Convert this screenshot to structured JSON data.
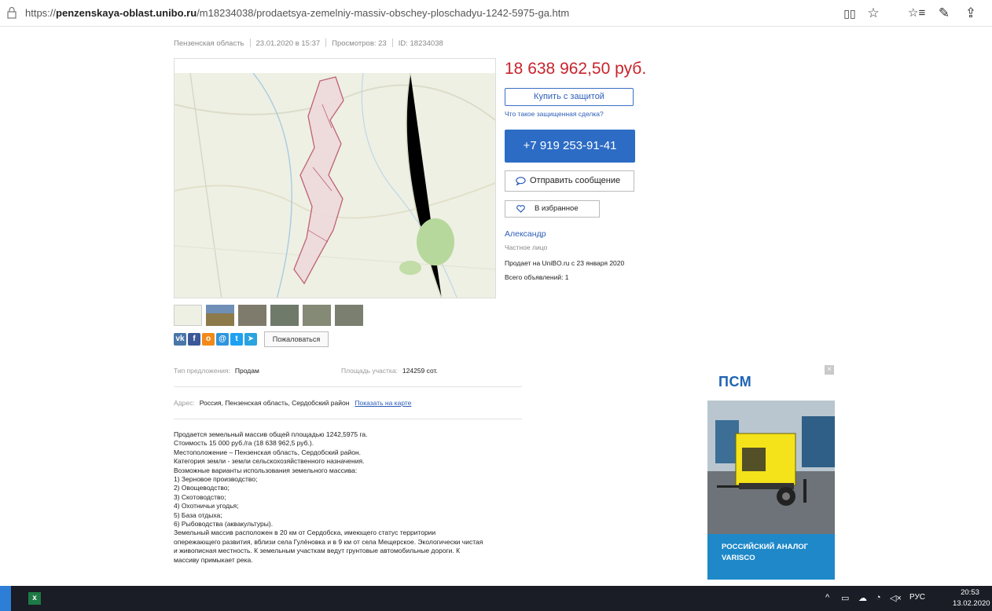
{
  "browser": {
    "url_prefix": "https://",
    "url_domain": "penzenskaya-oblast.unibo.ru",
    "url_path": "/m18234038/prodaetsya-zemelniy-massiv-obschey-ploschadyu-1242-5975-ga.htm"
  },
  "meta": {
    "region": "Пензенская область",
    "date": "23.01.2020 в 15:37",
    "views": "Просмотров: 23",
    "id": "ID: 18234038"
  },
  "listing": {
    "price": "18 638 962,50 руб.",
    "buy_protect_label": "Купить с защитой",
    "safe_deal_link": "Что такое защищенная сделка?",
    "phone": "+7 919 253-91-41",
    "message_label": "Отправить сообщение",
    "favorite_label": "В избранное"
  },
  "seller": {
    "name": "Александр",
    "type": "Частное лицо",
    "since": "Продает на UniBO.ru с 23 января 2020",
    "count": "Всего объявлений: 1"
  },
  "social": {
    "complain_label": "Пожаловаться",
    "items": [
      "vk",
      "facebook",
      "odnoklassniki",
      "moimir",
      "twitter",
      "telegram"
    ]
  },
  "details": {
    "offer_type_label": "Тип предложения:",
    "offer_type_value": "Продам",
    "area_label": "Площадь участка:",
    "area_value": "124259 сот.",
    "address_label": "Адрес:",
    "address_value": "Россия, Пензенская область, Сердобский район",
    "show_on_map": "Показать на карте"
  },
  "description": [
    "Продается земельный массив общей площадью 1242,5975 га.",
    "Стоимость 15 000 руб./га (18 638 962,5 руб.).",
    "Местоположение – Пензенская область, Сердобский район.",
    "Категория земли - земли сельскохозяйственного назначения.",
    "Возможные варианты использования земельного массива:",
    "1) Зерновое производство;",
    "2) Овощеводство;",
    "3) Скотоводство;",
    "4) Охотничьи угодья;",
    "5) База отдыха;",
    "6) Рыбоводства (аквакультуры).",
    "Земельный массив расположен в 20 км от Сердобска, имеющего статус территории",
    "опережающего развития, вблизи села Гулёновка и в 9 км от села Мещерское. Экологически чистая",
    "и живописная местность. К земельным участкам ведут грунтовые автомобильные дороги. К",
    "массиву примыкает река."
  ],
  "ad": {
    "logo": "ПСМ",
    "line1": "РОССИЙСКИЙ АНАЛОГ",
    "line2": "VARISCO",
    "close": "×"
  },
  "taskbar": {
    "lang": "РУС",
    "time": "20:53",
    "date": "13.02.2020"
  },
  "colors": {
    "price": "#c8232c",
    "accent": "#2d6cc5",
    "link": "#2c5cb8",
    "ad": "#1e88c9"
  }
}
